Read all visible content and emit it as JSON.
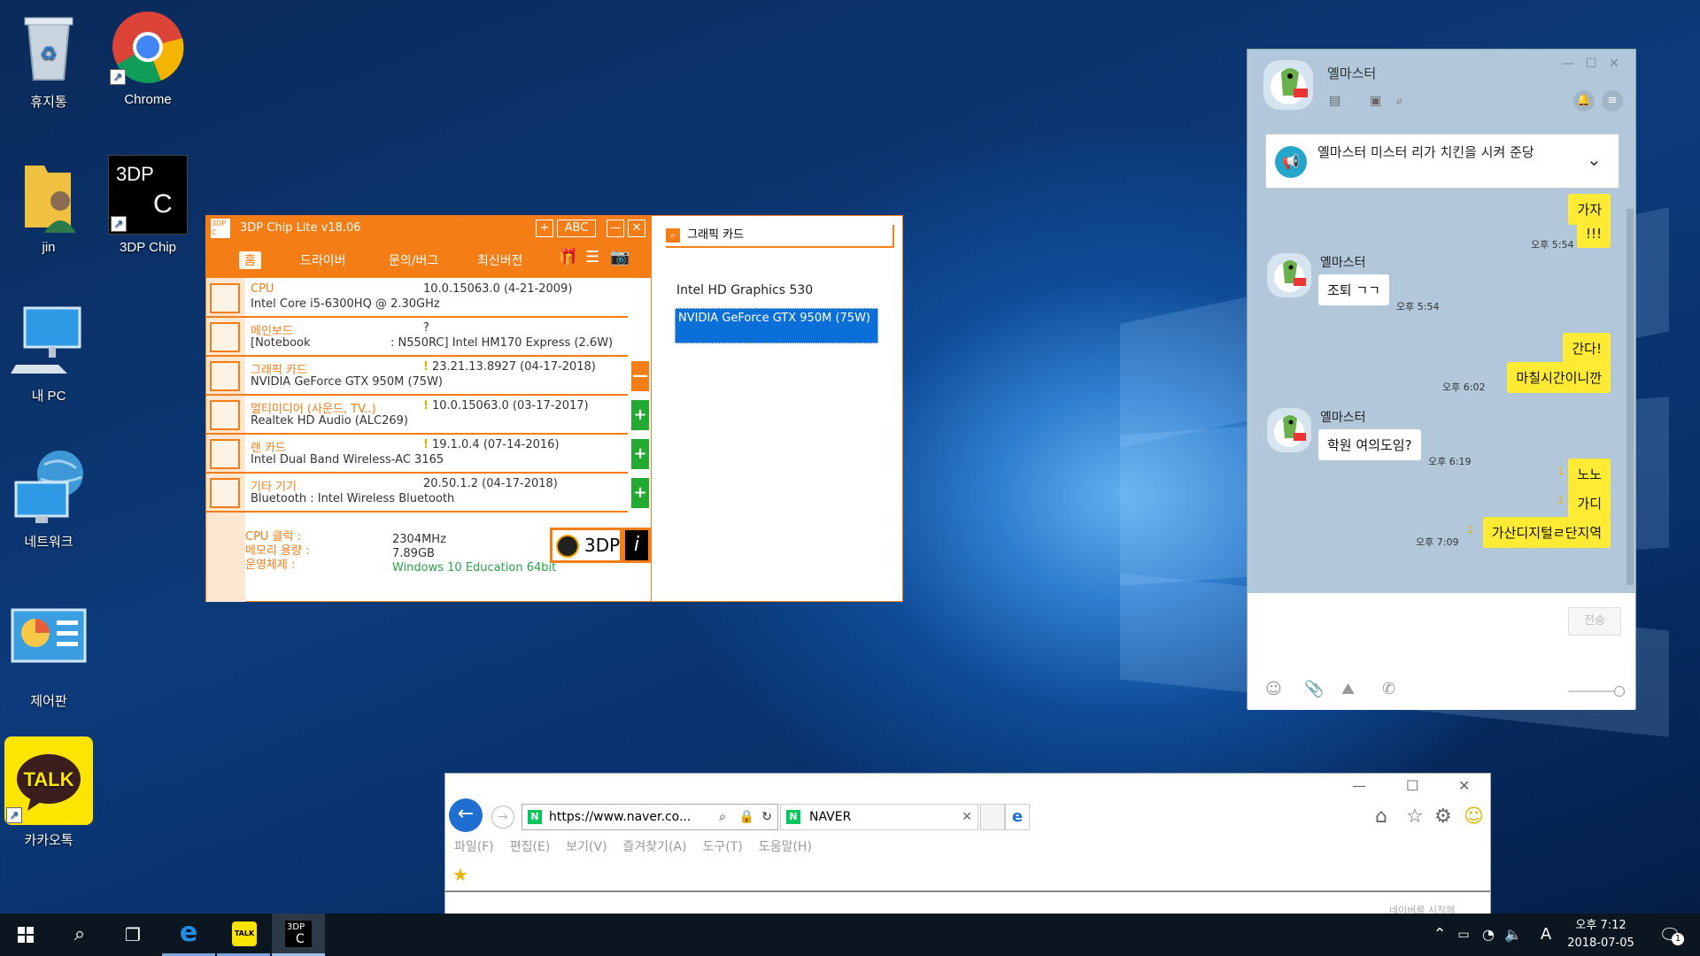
{
  "desktop": {
    "icons": [
      {
        "label": "휴지통",
        "icon": "recycle-bin-icon"
      },
      {
        "label": "Chrome",
        "icon": "chrome-icon"
      },
      {
        "label": "jin",
        "icon": "user-folder-icon"
      },
      {
        "label": "3DP Chip",
        "icon": "3dp-chip-icon"
      },
      {
        "label": "내 PC",
        "icon": "this-pc-icon"
      },
      {
        "label": "네트워크",
        "icon": "network-icon"
      },
      {
        "label": "제어판",
        "icon": "control-panel-icon"
      },
      {
        "label": "카카오톡",
        "icon": "kakaotalk-icon"
      }
    ]
  },
  "chip": {
    "title": "3DP Chip Lite v18.06",
    "logo": "3DP C",
    "title_buttons": {
      "plus": "+",
      "abc": "ABC",
      "minimize": "—",
      "close": "✕"
    },
    "menu": [
      "홈",
      "드라이버",
      "문의/버그",
      "최신버전"
    ],
    "devices": [
      {
        "name": "CPU",
        "desc": "Intel Core i5-6300HQ @ 2.30GHz",
        "ver": "10.0.15063.0 (4-21-2009)",
        "warn": false,
        "btn": ""
      },
      {
        "name": "메인보드",
        "desc": "[Notebook",
        "extra": ": N550RC] Intel HM170 Express (2.6W)",
        "ver": "?",
        "warn": false,
        "btn": ""
      },
      {
        "name": "그래픽 카드",
        "desc": "NVIDIA GeForce GTX 950M (75W)",
        "ver": "23.21.13.8927 (04-17-2018)",
        "warn": true,
        "btn": "—"
      },
      {
        "name": "멀티미디어 (사운드, TV..)",
        "desc": "Realtek HD Audio (ALC269)",
        "ver": "10.0.15063.0 (03-17-2017)",
        "warn": true,
        "btn": "+"
      },
      {
        "name": "랜 카드",
        "desc": "Intel Dual Band Wireless-AC 3165",
        "ver": "19.1.0.4 (07-14-2016)",
        "warn": true,
        "btn": "+"
      },
      {
        "name": "기타 기기",
        "desc": "Bluetooth : Intel Wireless Bluetooth",
        "ver": "20.50.1.2 (04-17-2018)",
        "warn": false,
        "btn": "+"
      }
    ],
    "info": {
      "cpu_clock_label": "CPU 클럭 :",
      "cpu_clock": "2304MHz",
      "memory_label": "메모리 용량 :",
      "memory": "7.89GB",
      "os_label": "운영체제 :",
      "os": "Windows 10 Education 64bit"
    },
    "brand": "3DP",
    "panel_title": "그래픽 카드",
    "gpu_list": [
      "Intel HD Graphics 530",
      "NVIDIA GeForce GTX 950M (75W)"
    ],
    "colors": {
      "accent": "#f57d16",
      "selected": "#0a6fd6",
      "plus": "#22aa33"
    }
  },
  "kakao": {
    "title": "옐마스터",
    "notice": "옐마스터 미스터 리가 치킨을 시켜 준당",
    "messages": [
      {
        "from": "me",
        "text": "가자"
      },
      {
        "from": "me",
        "text": "!!!",
        "time": "오후 5:54"
      },
      {
        "from": "you",
        "name": "옐마스터",
        "text": "조퇴 ㄱㄱ",
        "time": "오후 5:54"
      },
      {
        "from": "me",
        "text": "간다!"
      },
      {
        "from": "me",
        "text": "마칠시간이니깐",
        "time": "오후 6:02"
      },
      {
        "from": "you",
        "name": "옐마스터",
        "text": "학원 여의도임?",
        "time": "오후 6:19"
      },
      {
        "from": "me",
        "text": "노노",
        "unread": "1"
      },
      {
        "from": "me",
        "text": "가디",
        "unread": "1"
      },
      {
        "from": "me",
        "text": "가산디지털ㄹ단지역",
        "time": "오후 7:09",
        "unread": "1"
      }
    ],
    "send": "전송"
  },
  "ie": {
    "url": "https://www.naver.co...",
    "tab": "NAVER",
    "menu": [
      "파일(F)",
      "편집(E)",
      "보기(V)",
      "즐겨찾기(A)",
      "도구(T)",
      "도움말(H)"
    ],
    "page_hint": "네이버를 시작페"
  },
  "taskbar": {
    "time": "오후 7:12",
    "date": "2018-07-05",
    "ime": "A",
    "notif_count": "1",
    "3dp_label": "3DP"
  }
}
